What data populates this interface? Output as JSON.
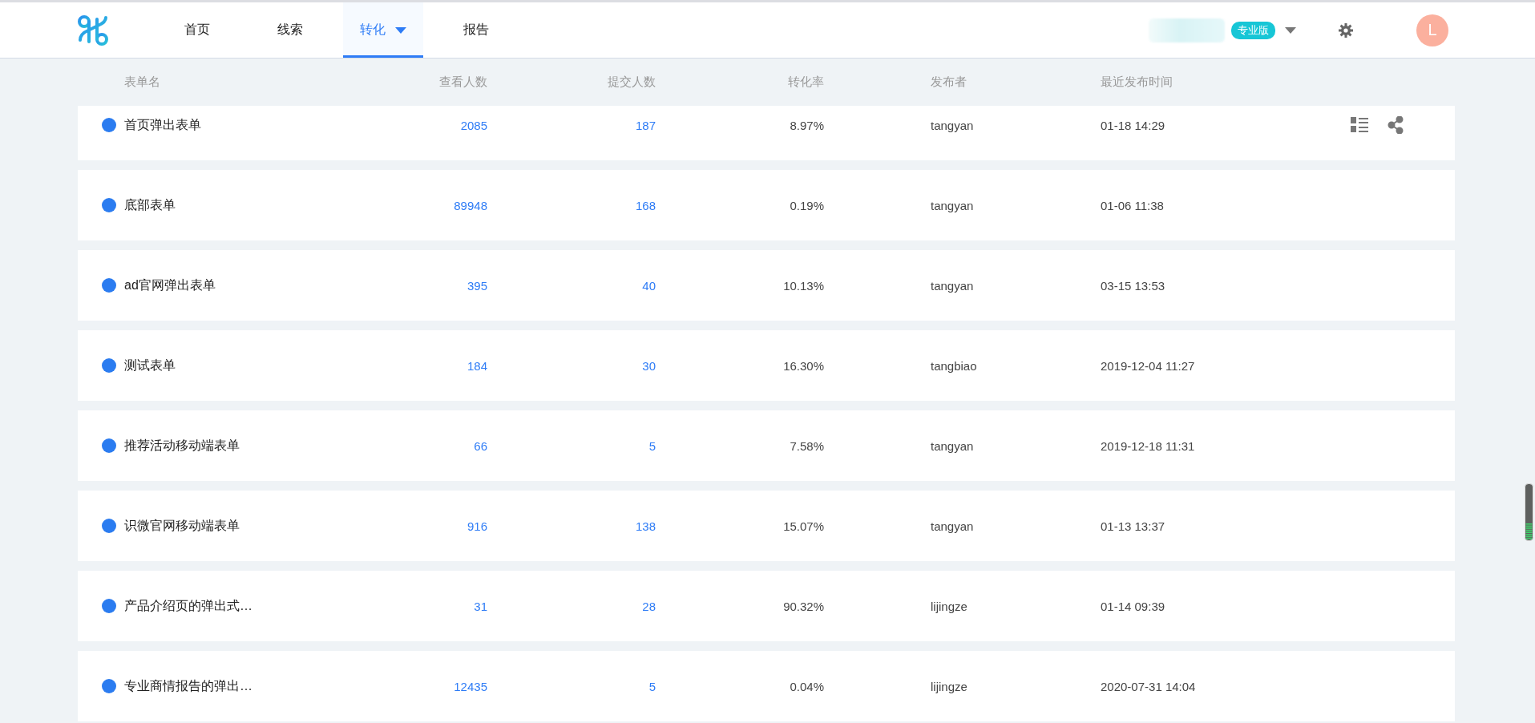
{
  "nav": {
    "items": [
      {
        "label": "首页",
        "selected": false,
        "dropdown": false
      },
      {
        "label": "线索",
        "selected": false,
        "dropdown": false
      },
      {
        "label": "转化",
        "selected": true,
        "dropdown": true
      },
      {
        "label": "报告",
        "selected": false,
        "dropdown": false
      }
    ],
    "plan_badge": "专业版",
    "avatar_letter": "L"
  },
  "table": {
    "columns": [
      "表单名",
      "查看人数",
      "提交人数",
      "转化率",
      "发布者",
      "最近发布时间"
    ],
    "rows": [
      {
        "name": "首页弹出表单",
        "views": "2085",
        "submits": "187",
        "rate": "8.97%",
        "publisher": "tangyan",
        "time": "01-18 14:29",
        "hovered": true
      },
      {
        "name": "底部表单",
        "views": "89948",
        "submits": "168",
        "rate": "0.19%",
        "publisher": "tangyan",
        "time": "01-06 11:38",
        "hovered": false
      },
      {
        "name": "ad官网弹出表单",
        "views": "395",
        "submits": "40",
        "rate": "10.13%",
        "publisher": "tangyan",
        "time": "03-15 13:53",
        "hovered": false
      },
      {
        "name": "测试表单",
        "views": "184",
        "submits": "30",
        "rate": "16.30%",
        "publisher": "tangbiao",
        "time": "2019-12-04 11:27",
        "hovered": false
      },
      {
        "name": "推荐活动移动端表单",
        "views": "66",
        "submits": "5",
        "rate": "7.58%",
        "publisher": "tangyan",
        "time": "2019-12-18 11:31",
        "hovered": false
      },
      {
        "name": "识微官网移动端表单",
        "views": "916",
        "submits": "138",
        "rate": "15.07%",
        "publisher": "tangyan",
        "time": "01-13 13:37",
        "hovered": false
      },
      {
        "name": "产品介绍页的弹出式…",
        "views": "31",
        "submits": "28",
        "rate": "90.32%",
        "publisher": "lijingze",
        "time": "01-14 09:39",
        "hovered": false
      },
      {
        "name": "专业商情报告的弹出…",
        "views": "12435",
        "submits": "5",
        "rate": "0.04%",
        "publisher": "lijingze",
        "time": "2020-07-31 14:04",
        "hovered": false
      }
    ]
  }
}
